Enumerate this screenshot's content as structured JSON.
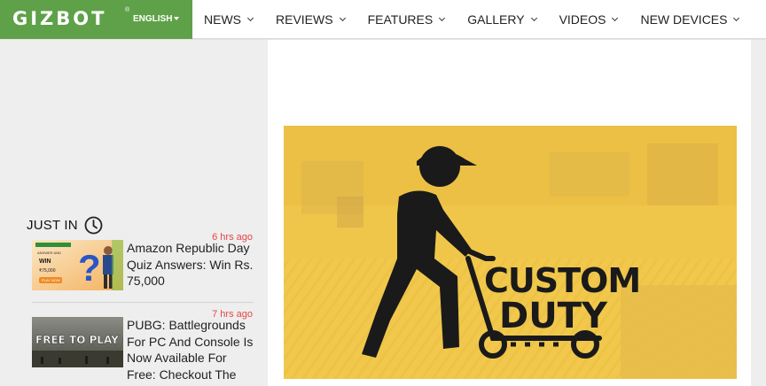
{
  "header": {
    "logo_text": "GIZBOT",
    "logo_reg": "®",
    "language": "ENGLISH",
    "nav": [
      {
        "label": "NEWS"
      },
      {
        "label": "REVIEWS"
      },
      {
        "label": "FEATURES"
      },
      {
        "label": "GALLERY"
      },
      {
        "label": "VIDEOS"
      },
      {
        "label": "NEW DEVICES"
      }
    ]
  },
  "sidebar": {
    "just_in_title": "JUST IN",
    "items": [
      {
        "time": "6 hrs ago",
        "headline": "Amazon Republic Day Quiz Answers: Win Rs. 75,000",
        "thumb_text": [
          "ANSWER AND",
          "WIN",
          "₹75,000",
          "PLAY NOW"
        ]
      },
      {
        "time": "7 hrs ago",
        "headline": "PUBG: Battlegrounds For PC And Console Is Now Available For Free: Checkout The",
        "thumb_text": [
          "FREE TO PLAY NOW"
        ]
      }
    ]
  },
  "article": {
    "hero_text": [
      "CUSTOM",
      "DUTY"
    ]
  },
  "colors": {
    "brand_green": "#5fa148",
    "time_red": "#e64545",
    "hero_yellow": "#f1c94d"
  }
}
